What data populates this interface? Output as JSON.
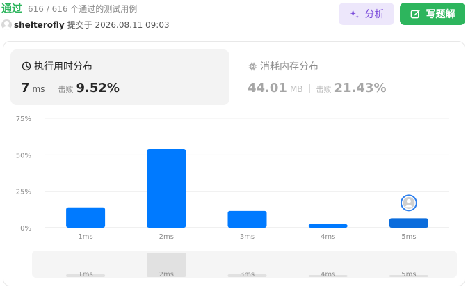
{
  "header": {
    "status": "通过",
    "cases": "616 / 616 个通过的测试用例",
    "username": "shelterofly",
    "submitted": "提交于 2026.08.11 09:03"
  },
  "actions": {
    "analyze": "分析",
    "write_solution": "写题解",
    "analyze_icon": "sparkle-icon",
    "solution_icon": "edit-icon"
  },
  "runtime": {
    "title": "执行用时分布",
    "value": "7",
    "unit": "ms",
    "beat_label": "击败",
    "beat": "9.52%",
    "icon": "clock-icon"
  },
  "memory": {
    "title": "消耗内存分布",
    "value": "44.01",
    "unit": "MB",
    "beat_label": "击败",
    "beat": "21.43%",
    "icon": "chip-icon"
  },
  "colors": {
    "accent_green": "#2db55d",
    "bar": "#007aff",
    "bar_current": "#0a6cdc"
  },
  "chart_data": {
    "type": "bar",
    "categories": [
      "1ms",
      "2ms",
      "3ms",
      "4ms",
      "5ms"
    ],
    "values": [
      14,
      54,
      11.5,
      2.5,
      6.5
    ],
    "y_ticks": [
      "0%",
      "25%",
      "50%",
      "75%"
    ],
    "ylim": [
      0,
      75
    ],
    "grid": true,
    "current_category": "5ms",
    "overview_categories": [
      "1ms",
      "2ms",
      "3ms",
      "4ms",
      "5ms"
    ],
    "overview_values": [
      4,
      35,
      4,
      3,
      3
    ]
  }
}
